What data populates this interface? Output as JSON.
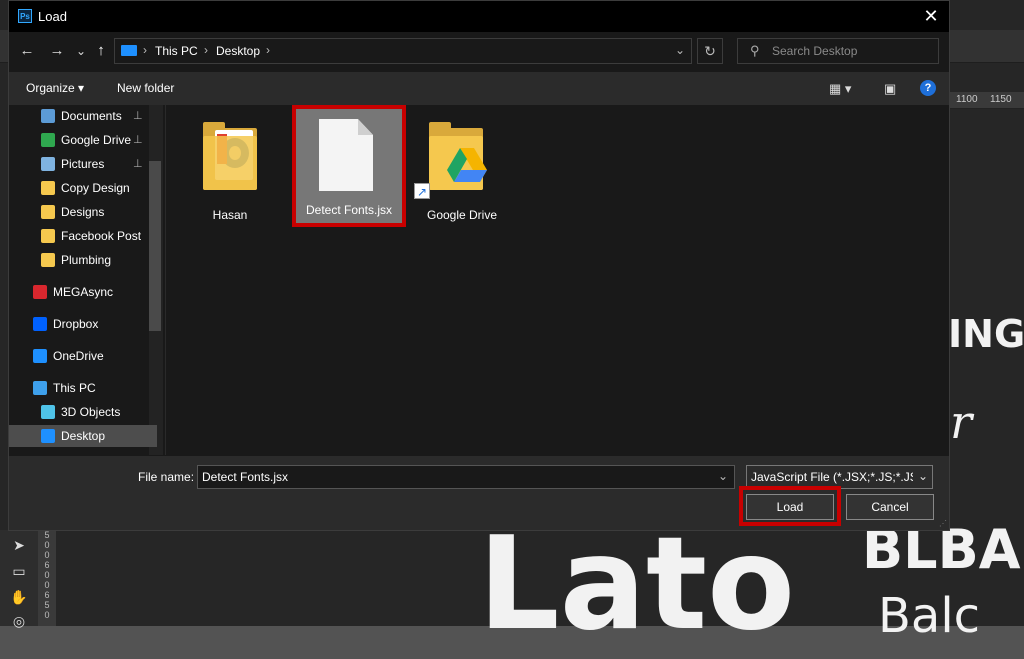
{
  "dialog": {
    "title": "Load",
    "app_badge": "Ps",
    "close_glyph": "✕"
  },
  "nav": {
    "back_glyph": "←",
    "forward_glyph": "→",
    "recent_glyph": "⌄",
    "up_glyph": "↑",
    "breadcrumb": [
      "This PC",
      "Desktop"
    ],
    "refresh_glyph": "↻",
    "search_placeholder": "Search Desktop"
  },
  "commands": {
    "organize": "Organize ▾",
    "new_folder": "New folder",
    "help": "?"
  },
  "sidebar": {
    "items": [
      {
        "label": "Documents",
        "icon": "documents-icon",
        "pinned": true,
        "color": "#5c9bd6"
      },
      {
        "label": "Google Drive",
        "icon": "google-drive-icon",
        "pinned": true,
        "color": "#2fa84f"
      },
      {
        "label": "Pictures",
        "icon": "pictures-icon",
        "pinned": true,
        "color": "#7fb3e0"
      },
      {
        "label": "Copy Design",
        "icon": "folder-icon",
        "pinned": false,
        "color": "#f5c84e"
      },
      {
        "label": "Designs",
        "icon": "folder-icon",
        "pinned": false,
        "color": "#f5c84e"
      },
      {
        "label": "Facebook Post",
        "icon": "folder-icon",
        "pinned": false,
        "color": "#f5c84e"
      },
      {
        "label": "Plumbing",
        "icon": "folder-icon",
        "pinned": false,
        "color": "#f5c84e"
      },
      {
        "label": "MEGAsync",
        "icon": "mega-icon",
        "pinned": false,
        "color": "#d9272e"
      },
      {
        "label": "Dropbox",
        "icon": "dropbox-icon",
        "pinned": false,
        "color": "#0061fe"
      },
      {
        "label": "OneDrive",
        "icon": "onedrive-icon",
        "pinned": false,
        "color": "#1e90ff"
      },
      {
        "label": "This PC",
        "icon": "pc-icon",
        "pinned": false,
        "color": "#3ea0ec"
      },
      {
        "label": "3D Objects",
        "icon": "3d-objects-icon",
        "pinned": false,
        "color": "#4fc3e8"
      },
      {
        "label": "Desktop",
        "icon": "desktop-icon",
        "pinned": false,
        "color": "#1e90ff",
        "selected": true
      }
    ],
    "pin_glyph": "📌"
  },
  "files": [
    {
      "name": "Hasan",
      "type": "folder"
    },
    {
      "name": "Detect Fonts.jsx",
      "type": "document",
      "selected": true
    },
    {
      "name": "Google Drive",
      "type": "folder-shortcut"
    }
  ],
  "bottom": {
    "file_name_label": "File name:",
    "file_name_value": "Detect Fonts.jsx",
    "file_type_value": "JavaScript File (*.JSX;*.JS;*.JSXBI",
    "load_label": "Load",
    "cancel_label": "Cancel"
  },
  "background": {
    "ruler_ticks": [
      "1100",
      "1150"
    ],
    "canvas_texts": [
      "ING",
      "r",
      "BLBA",
      "Lato",
      "Balc"
    ],
    "vruler": "5\n0\n0\n6\n0\n0\n6\n5\n0"
  },
  "colors": {
    "highlight_red": "#c80000",
    "dialog_bg": "#191919",
    "selection": "#4d4d4d"
  }
}
